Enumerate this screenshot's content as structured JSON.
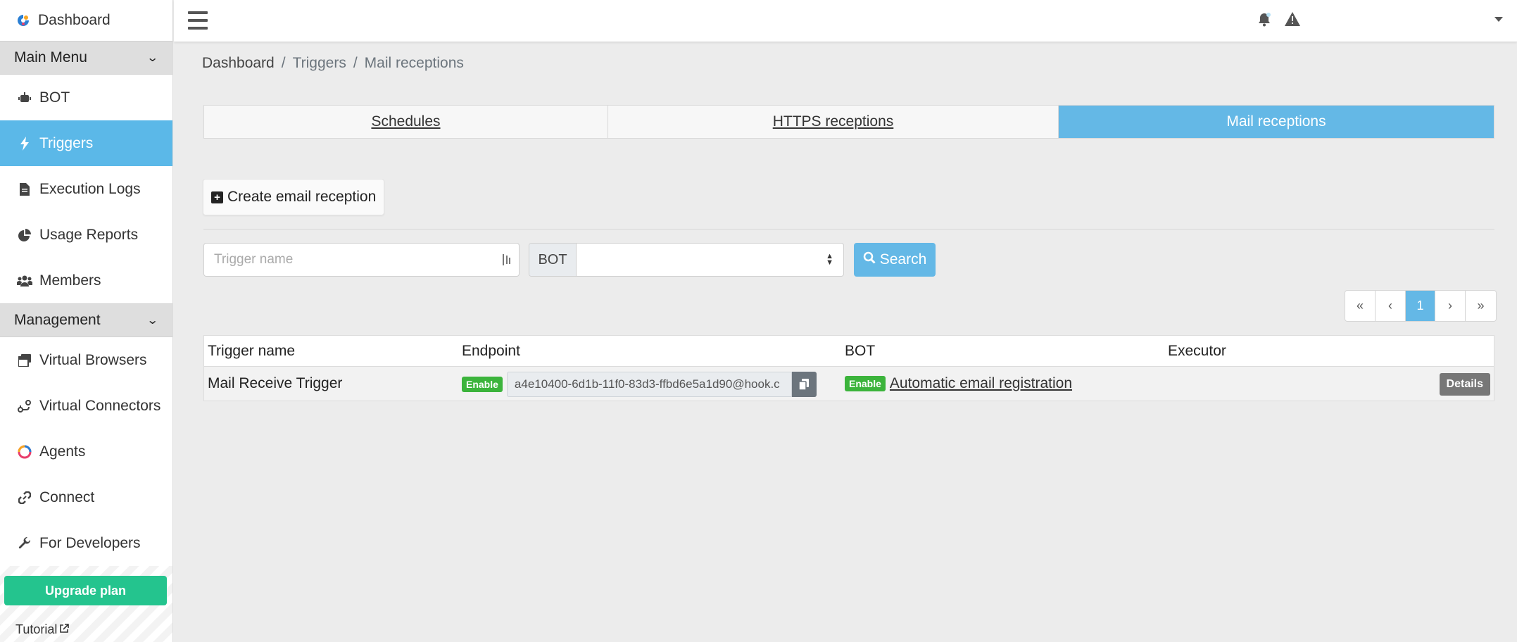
{
  "brand": {
    "label": "Dashboard"
  },
  "sidebar": {
    "sections": [
      {
        "title": "Main Menu"
      },
      {
        "title": "Management"
      }
    ],
    "main_items": [
      {
        "label": "BOT",
        "icon": "robot-icon"
      },
      {
        "label": "Triggers",
        "icon": "bolt-icon",
        "active": true
      },
      {
        "label": "Execution Logs",
        "icon": "file-icon"
      },
      {
        "label": "Usage Reports",
        "icon": "pie-chart-icon"
      },
      {
        "label": "Members",
        "icon": "users-icon"
      }
    ],
    "management_items": [
      {
        "label": "Virtual Browsers",
        "icon": "window-stack-icon"
      },
      {
        "label": "Virtual Connectors",
        "icon": "connector-icon"
      },
      {
        "label": "Agents",
        "icon": "agent-logo-icon"
      },
      {
        "label": "Connect",
        "icon": "link-icon"
      },
      {
        "label": "For Developers",
        "icon": "wrench-icon"
      }
    ],
    "upgrade_label": "Upgrade plan",
    "tutorial_label": "Tutorial"
  },
  "breadcrumb": [
    "Dashboard",
    "Triggers",
    "Mail receptions"
  ],
  "tabs": [
    {
      "label": "Schedules",
      "active": false
    },
    {
      "label": "HTTPS receptions",
      "active": false
    },
    {
      "label": "Mail receptions",
      "active": true
    }
  ],
  "create_button_label": "Create email reception",
  "filters": {
    "trigger_placeholder": "Trigger name",
    "trigger_value": "",
    "bot_addon": "BOT",
    "bot_selected": "",
    "search_label": "Search"
  },
  "pagination": {
    "current": "1"
  },
  "table": {
    "headers": [
      "Trigger name",
      "Endpoint",
      "BOT",
      "Executor"
    ],
    "rows": [
      {
        "trigger_name": "Mail Receive Trigger",
        "endpoint_status": "Enable",
        "endpoint": "a4e10400-6d1b-11f0-83d3-ffbd6e5a1d90@hook.c",
        "bot_status": "Enable",
        "bot_name": "Automatic email registration",
        "executor": "",
        "details_label": "Details"
      }
    ]
  },
  "colors": {
    "accent": "#64b8e6",
    "success": "#3cb43c",
    "upgrade": "#24c48e"
  }
}
